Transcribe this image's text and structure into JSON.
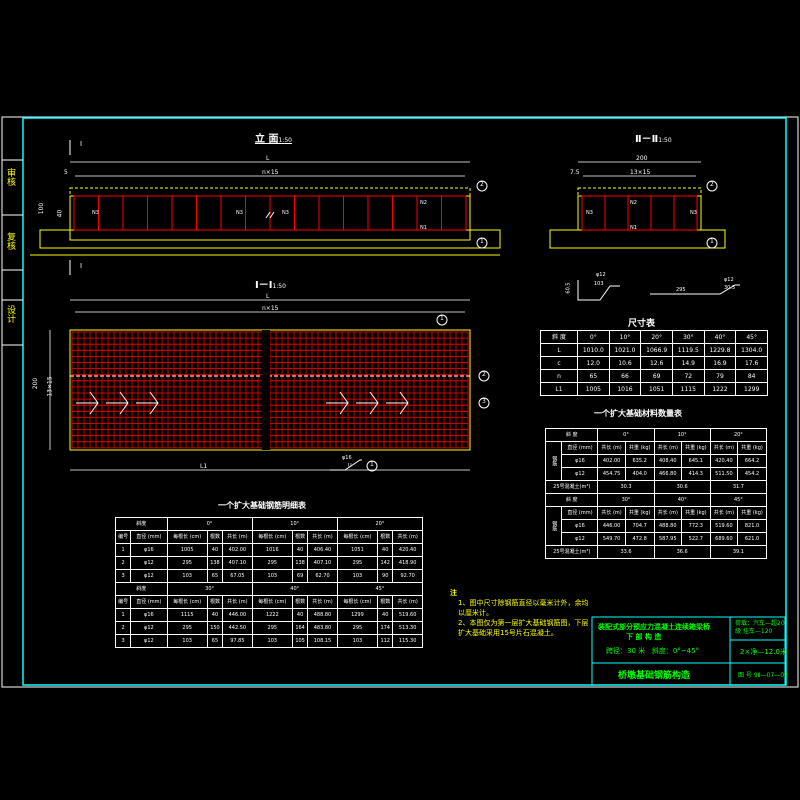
{
  "side_labels": [
    "审核",
    "复核",
    "设计"
  ],
  "views": {
    "elevation_title": "立 面",
    "elevation_scale": "1:50",
    "section1_title": "Ⅱ－Ⅱ",
    "section1_scale": "1:50",
    "plan_title": "Ⅰ－Ⅰ",
    "plan_scale": "1:50",
    "dim_L": "L",
    "dim_n15": "n×15",
    "dim_L1": "L1",
    "dim_200": "200",
    "dim_13x15": "13×15",
    "dim_5": "5",
    "dim_7_5": "7.5",
    "dim_100": "100",
    "dim_40": "40",
    "dim_cut": "Ⅰ",
    "dim_cut2": "Ⅱ",
    "labels_n": [
      "N1",
      "N2",
      "N3"
    ],
    "bar_callout1": "φ12",
    "bar_callout1b": "103",
    "bar_callout1c": "60.5",
    "bar_callout2": "φ12",
    "bar_callout2b": "295",
    "bar_callout2c": "30.5",
    "bar_callout3": "φ16",
    "bar_callout3b": "U",
    "circle1": "1",
    "circle2": "2",
    "circle3": "3"
  },
  "size_table": {
    "title": "尺寸表",
    "header": [
      "斜 度",
      "0°",
      "10°",
      "20°",
      "30°",
      "40°",
      "45°"
    ],
    "rows": [
      [
        "L",
        "1010.0",
        "1021.0",
        "1066.9",
        "1119.5",
        "1229.8",
        "1304.0"
      ],
      [
        "c",
        "12.0",
        "10.6",
        "12.6",
        "14.9",
        "16.9",
        "17.6"
      ],
      [
        "n",
        "65",
        "66",
        "69",
        "72",
        "79",
        "84"
      ],
      [
        "L1",
        "1005",
        "1016",
        "1051",
        "1115",
        "1222",
        "1299"
      ]
    ]
  },
  "material_table": {
    "title": "一个扩大基础材料数量表",
    "head_slope": "斜 度",
    "head_angles1": [
      "0°",
      "10°",
      "20°"
    ],
    "head_angles2": [
      "30°",
      "40°",
      "45°"
    ],
    "sub_head": [
      "直径\n(mm)",
      "共长\n(m)",
      "共重\n(kg)"
    ],
    "sub_labels": [
      "直径 (mm)",
      "共长 (m)",
      "共重 (kg)",
      "共长 (m)",
      "共重 (kg)",
      "共长 (m)",
      "共重 (kg)"
    ],
    "side": "钢筋",
    "rows1": [
      [
        "φ16",
        "402.00",
        "635.2",
        "408.40",
        "645.1",
        "420.40",
        "664.2"
      ],
      [
        "φ12",
        "454.75",
        "404.0",
        "466.80",
        "414.3",
        "511.50",
        "454.2"
      ]
    ],
    "conc1": [
      "25号混凝土(m³)",
      "30.3",
      "30.6",
      "31.7"
    ],
    "rows2": [
      [
        "φ16",
        "446.00",
        "704.7",
        "488.80",
        "772.3",
        "519.60",
        "821.0"
      ],
      [
        "φ12",
        "549.70",
        "472.8",
        "587.95",
        "522.7",
        "689.60",
        "621.0"
      ]
    ],
    "conc2": [
      "25号混凝土(m³)",
      "33.6",
      "36.6",
      "39.1"
    ]
  },
  "rebar_table": {
    "title": "一个扩大基础钢筋明细表",
    "head1": [
      "斜度",
      "0°",
      "10°",
      "20°"
    ],
    "head2": [
      "斜度",
      "30°",
      "40°",
      "45°"
    ],
    "sub": [
      "编号",
      "直径\n(mm)",
      "每根长\n(cm)",
      "根数",
      "共长\n(m)",
      "每根长\n(cm)",
      "根数",
      "共长\n(m)",
      "每根长\n(cm)",
      "根数",
      "共长\n(m)"
    ],
    "sub_flat": [
      "编号",
      "直径 (mm)",
      "每根长 (cm)",
      "根数",
      "共长 (m)",
      "每根长 (cm)",
      "根数",
      "共长 (m)",
      "每根长 (cm)",
      "根数",
      "共长 (m)"
    ],
    "rows1": [
      [
        "1",
        "φ16",
        "1005",
        "40",
        "402.00",
        "1016",
        "40",
        "406.40",
        "1051",
        "40",
        "420.40"
      ],
      [
        "2",
        "φ12",
        "295",
        "138",
        "407.10",
        "295",
        "138",
        "407.10",
        "295",
        "142",
        "418.90"
      ],
      [
        "3",
        "φ12",
        "103",
        "65",
        "67.05",
        "103",
        "69",
        "62.70",
        "103",
        "90",
        "92.70"
      ]
    ],
    "rows2": [
      [
        "1",
        "φ16",
        "1115",
        "40",
        "446.00",
        "1222",
        "40",
        "488.80",
        "1299",
        "40",
        "519.60"
      ],
      [
        "2",
        "φ12",
        "295",
        "150",
        "442.50",
        "295",
        "164",
        "483.80",
        "295",
        "174",
        "513.30"
      ],
      [
        "3",
        "φ12",
        "103",
        "65",
        "97.85",
        "103",
        "105",
        "108.15",
        "103",
        "112",
        "115.30"
      ]
    ]
  },
  "notes": {
    "title": "注",
    "items": [
      "1、图中尺寸除钢筋直径以毫米计外，余均以厘米计。",
      "2、本图仅为第一层扩大基础钢筋图，下层扩大基础采用15号片石混凝土。"
    ]
  },
  "title_block": {
    "project": "装配式部分预应力混凝土连续箱梁桥",
    "part": "下 部 构 造",
    "load": "荷载：汽车—超20级 挂车—120",
    "span_label": "跨径：",
    "span": "30 米",
    "skew_label": "斜度：",
    "skew": "0°~45°",
    "width": "2×净—12.0米",
    "drawing": "桥墩基础钢筋构造",
    "number": "图 号 9Ⅱ—07—02"
  },
  "colors": {
    "frame": "#00ffff",
    "rebar": "#ff0000",
    "concrete": "#ffff00",
    "text": "#ffffff",
    "accent": "#00ff00"
  }
}
